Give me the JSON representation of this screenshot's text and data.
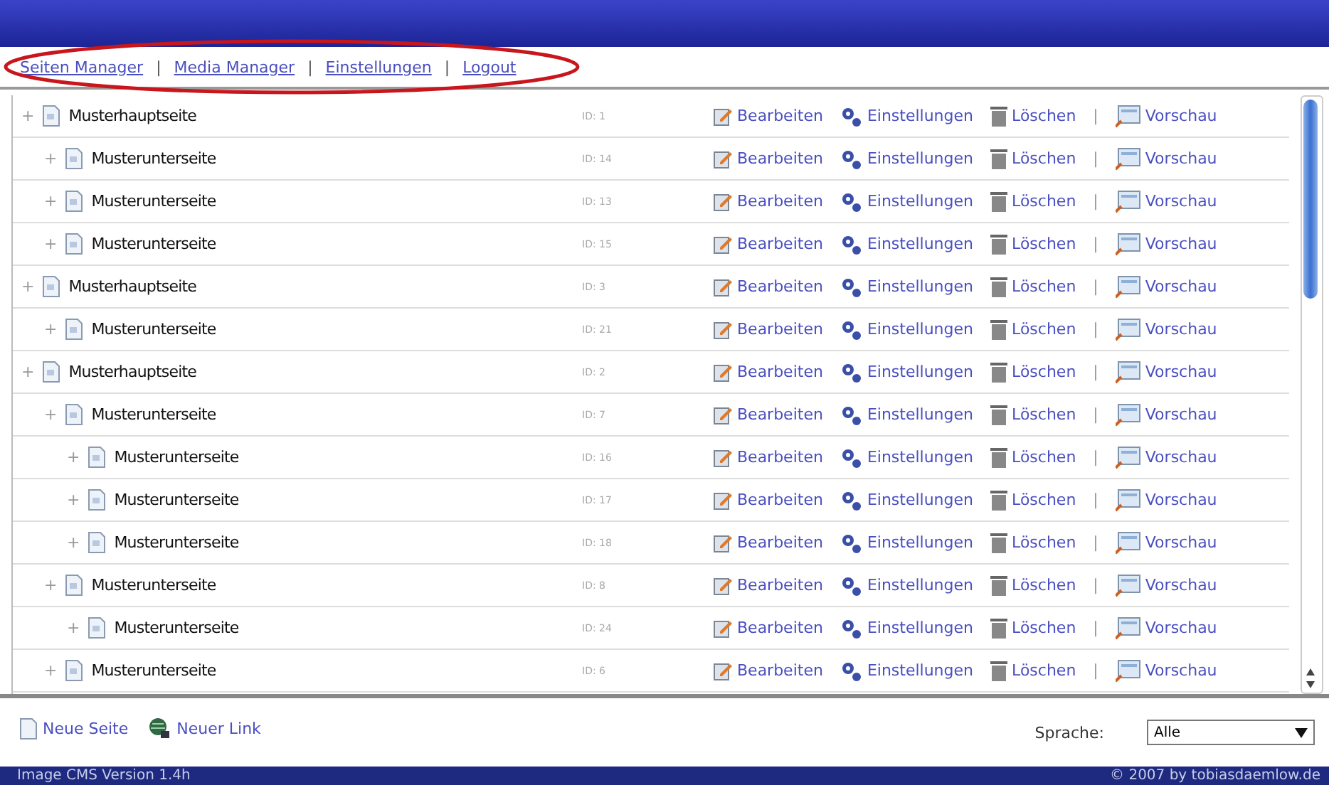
{
  "nav": [
    {
      "kind": "link",
      "label": "Seiten Manager"
    },
    {
      "kind": "separator",
      "label": "|"
    },
    {
      "kind": "link",
      "label": "Media Manager"
    },
    {
      "kind": "separator",
      "label": "|"
    },
    {
      "kind": "link",
      "label": "Einstellungen"
    },
    {
      "kind": "separator",
      "label": "|"
    },
    {
      "kind": "link",
      "label": "Logout"
    }
  ],
  "pages": [
    {
      "toggle": "+",
      "title": "Musterhauptseite",
      "id": "ID: 1",
      "actions": {
        "edit": "Bearbeiten",
        "settings": "Einstellungen",
        "delete": "Löschen",
        "separator": "|",
        "preview": "Vorschau"
      },
      "children": [
        {
          "toggle": "+",
          "title": "Musterunterseite",
          "id": "ID: 14",
          "actions": {
            "edit": "Bearbeiten",
            "settings": "Einstellungen",
            "delete": "Löschen",
            "separator": "|",
            "preview": "Vorschau"
          }
        },
        {
          "toggle": "+",
          "title": "Musterunterseite",
          "id": "ID: 13",
          "actions": {
            "edit": "Bearbeiten",
            "settings": "Einstellungen",
            "delete": "Löschen",
            "separator": "|",
            "preview": "Vorschau"
          }
        },
        {
          "toggle": "+",
          "title": "Musterunterseite",
          "id": "ID: 15",
          "actions": {
            "edit": "Bearbeiten",
            "settings": "Einstellungen",
            "delete": "Löschen",
            "separator": "|",
            "preview": "Vorschau"
          }
        }
      ]
    },
    {
      "toggle": "+",
      "title": "Musterhauptseite",
      "id": "ID: 3",
      "actions": {
        "edit": "Bearbeiten",
        "settings": "Einstellungen",
        "delete": "Löschen",
        "separator": "|",
        "preview": "Vorschau"
      },
      "children": [
        {
          "toggle": "+",
          "title": "Musterunterseite",
          "id": "ID: 21",
          "actions": {
            "edit": "Bearbeiten",
            "settings": "Einstellungen",
            "delete": "Löschen",
            "separator": "|",
            "preview": "Vorschau"
          }
        }
      ]
    },
    {
      "toggle": "+",
      "title": "Musterhauptseite",
      "id": "ID: 2",
      "actions": {
        "edit": "Bearbeiten",
        "settings": "Einstellungen",
        "delete": "Löschen",
        "separator": "|",
        "preview": "Vorschau"
      },
      "children": [
        {
          "toggle": "+",
          "title": "Musterunterseite",
          "id": "ID: 7",
          "actions": {
            "edit": "Bearbeiten",
            "settings": "Einstellungen",
            "delete": "Löschen",
            "separator": "|",
            "preview": "Vorschau"
          },
          "children": [
            {
              "toggle": "+",
              "title": "Musterunterseite",
              "id": "ID: 16",
              "actions": {
                "edit": "Bearbeiten",
                "settings": "Einstellungen",
                "delete": "Löschen",
                "separator": "|",
                "preview": "Vorschau"
              }
            },
            {
              "toggle": "+",
              "title": "Musterunterseite",
              "id": "ID: 17",
              "actions": {
                "edit": "Bearbeiten",
                "settings": "Einstellungen",
                "delete": "Löschen",
                "separator": "|",
                "preview": "Vorschau"
              }
            },
            {
              "toggle": "+",
              "title": "Musterunterseite",
              "id": "ID: 18",
              "actions": {
                "edit": "Bearbeiten",
                "settings": "Einstellungen",
                "delete": "Löschen",
                "separator": "|",
                "preview": "Vorschau"
              }
            }
          ]
        },
        {
          "toggle": "+",
          "title": "Musterunterseite",
          "id": "ID: 8",
          "actions": {
            "edit": "Bearbeiten",
            "settings": "Einstellungen",
            "delete": "Löschen",
            "separator": "|",
            "preview": "Vorschau"
          },
          "children": [
            {
              "toggle": "+",
              "title": "Musterunterseite",
              "id": "ID: 24",
              "actions": {
                "edit": "Bearbeiten",
                "settings": "Einstellungen",
                "delete": "Löschen",
                "separator": "|",
                "preview": "Vorschau"
              }
            }
          ]
        },
        {
          "toggle": "+",
          "title": "Musterunterseite",
          "id": "ID: 6",
          "actions": {
            "edit": "Bearbeiten",
            "settings": "Einstellungen",
            "delete": "Löschen",
            "separator": "|",
            "preview": "Vorschau"
          }
        }
      ]
    }
  ],
  "bottom_links": [
    {
      "label": "Neue Seite",
      "kind": "page"
    },
    {
      "label": "Neuer Link",
      "kind": "link"
    }
  ],
  "language": {
    "label": "Sprache:",
    "value": "Alle"
  },
  "footer": {
    "left": "Image CMS Version 1.4h",
    "right": "© 2007 by tobiasdaemlow.de"
  }
}
